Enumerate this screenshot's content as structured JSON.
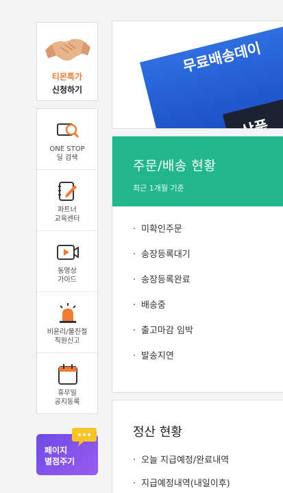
{
  "promo": {
    "title": "티몬특가",
    "subtitle": "신청하기"
  },
  "menu": {
    "items": [
      {
        "label": "ONE STOP\n딜 검색",
        "icon": "search-icon"
      },
      {
        "label": "파트너\n교육센터",
        "icon": "edit-note-icon"
      },
      {
        "label": "동영상\n가이드",
        "icon": "video-play-icon"
      },
      {
        "label": "비윤리/불친절\n직원신고",
        "icon": "siren-icon"
      },
      {
        "label": "휴무일\n공지등록",
        "icon": "calendar-icon"
      }
    ]
  },
  "rating": {
    "label": "페이지\n별점주기"
  },
  "banner": {
    "headline": "무료배송데이",
    "tag": "상품"
  },
  "order_status": {
    "title": "주문/배송 현황",
    "subtitle": "최근 1개월 기준",
    "items": [
      "미확인주문",
      "송장등록대기",
      "송장등록완료",
      "배송중",
      "출고마감 임박",
      "발송지연"
    ]
  },
  "settlement": {
    "title": "정산 현황",
    "items": [
      "오늘 지급예정/완료내역",
      "지급예정내역(내일이후)"
    ]
  },
  "colors": {
    "accent_green": "#21b68c",
    "promo_orange": "#f07b32",
    "rating_purple": "#7a52ea"
  }
}
